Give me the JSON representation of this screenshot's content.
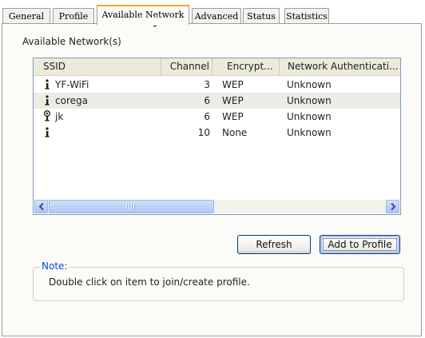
{
  "tabs": [
    {
      "label": "General"
    },
    {
      "label": "Profile"
    },
    {
      "label": "Available Network",
      "active": true
    },
    {
      "label": "Advanced"
    },
    {
      "label": "Status"
    },
    {
      "label": "Statistics"
    }
  ],
  "group_title": "Available Network(s)",
  "list": {
    "columns": [
      "SSID",
      "Channel",
      "Encrypt...",
      "Network Authenticati..."
    ],
    "rows": [
      {
        "ssid": "YF-WiFi",
        "channel": "3",
        "encrypt": "WEP",
        "auth": "Unknown",
        "icon": "signal-icon"
      },
      {
        "ssid": "corega",
        "channel": "6",
        "encrypt": "WEP",
        "auth": "Unknown",
        "icon": "signal-icon"
      },
      {
        "ssid": "jk",
        "channel": "6",
        "encrypt": "WEP",
        "auth": "Unknown",
        "icon": "secured-network-icon"
      },
      {
        "ssid": "",
        "channel": "10",
        "encrypt": "None",
        "auth": "Unknown",
        "icon": "signal-icon"
      }
    ]
  },
  "buttons": {
    "refresh": "Refresh",
    "add_to_profile": "Add to Profile"
  },
  "note": {
    "title": "Note:",
    "text": "Double click on item to join/create profile."
  },
  "colors": {
    "active_tab_accent": "#f5a623",
    "note_title": "#0046d5",
    "button_border": "#003c74"
  }
}
